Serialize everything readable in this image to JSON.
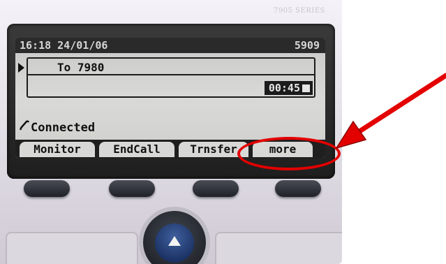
{
  "phone": {
    "model_label": "7905 SERIES",
    "status_bar": {
      "time_date": "16:18 24/01/06",
      "extension": "5909"
    },
    "active_call": {
      "destination": "To 7980",
      "duration": "00:45"
    },
    "call_state": "Connected",
    "softkeys": [
      {
        "label": "Monitor"
      },
      {
        "label": "EndCall"
      },
      {
        "label": "Trnsfer"
      },
      {
        "label": "more"
      }
    ]
  },
  "annotation": {
    "highlight_target": "more",
    "color": "#e30000"
  },
  "colors": {
    "lcd_background": "#d0d0cd",
    "bezel": "#1e1e1e",
    "nav_button": "#1a3163"
  }
}
